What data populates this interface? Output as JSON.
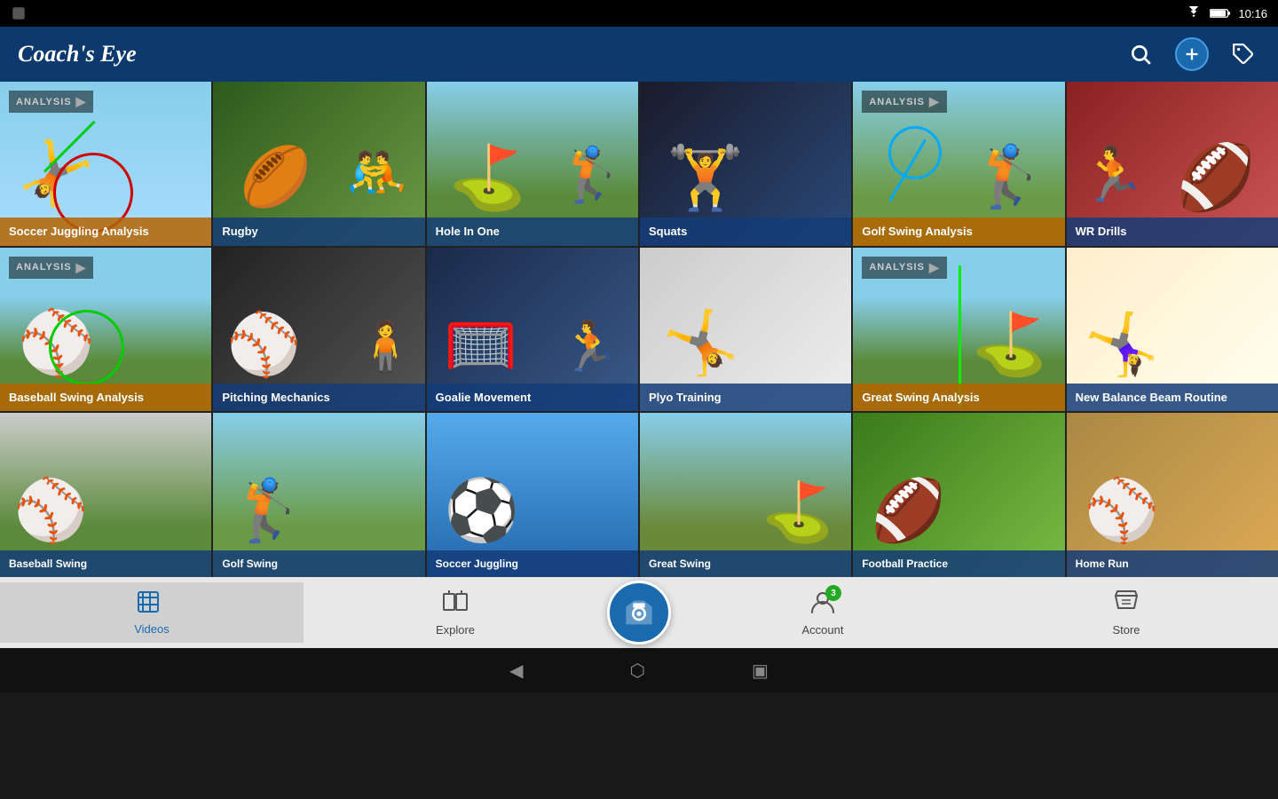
{
  "statusBar": {
    "time": "10:16",
    "icons": [
      "wifi",
      "battery"
    ]
  },
  "topBar": {
    "title": "Coach's Eye",
    "actions": [
      "search",
      "add",
      "tag"
    ]
  },
  "grid": {
    "rows": [
      [
        {
          "id": "soccer-juggling",
          "label": "Soccer Juggling Analysis",
          "hasAnalysis": true,
          "labelColor": "orange",
          "bgClass": "cell-soccer-juggling",
          "hasCircle": true,
          "highlighted": true
        },
        {
          "id": "rugby",
          "label": "Rugby",
          "hasAnalysis": false,
          "labelColor": "blue",
          "bgClass": "cell-rugby"
        },
        {
          "id": "hole-in-one",
          "label": "Hole In One",
          "hasAnalysis": false,
          "labelColor": "blue",
          "bgClass": "cell-hole-in-one"
        },
        {
          "id": "squats",
          "label": "Squats",
          "hasAnalysis": false,
          "labelColor": "blue",
          "bgClass": "cell-squats"
        },
        {
          "id": "golf-swing-analysis",
          "label": "Golf Swing Analysis",
          "hasAnalysis": true,
          "labelColor": "orange",
          "bgClass": "cell-golf-swing"
        },
        {
          "id": "wr-drills",
          "label": "WR Drills",
          "hasAnalysis": false,
          "labelColor": "blue",
          "bgClass": "cell-wr-drills"
        }
      ],
      [
        {
          "id": "baseball-swing-analysis",
          "label": "Baseball Swing Analysis",
          "hasAnalysis": true,
          "labelColor": "orange",
          "bgClass": "cell-baseball-swing",
          "hasCircleGreen": true
        },
        {
          "id": "pitching-mechanics",
          "label": "Pitching Mechanics",
          "hasAnalysis": false,
          "labelColor": "blue",
          "bgClass": "cell-pitching"
        },
        {
          "id": "goalie-movement",
          "label": "Goalie Movement",
          "hasAnalysis": false,
          "labelColor": "blue",
          "bgClass": "cell-goalie"
        },
        {
          "id": "plyo-training",
          "label": "Plyo Training",
          "hasAnalysis": false,
          "labelColor": "blue",
          "bgClass": "cell-plyo"
        },
        {
          "id": "great-swing-analysis",
          "label": "Great Swing Analysis",
          "hasAnalysis": true,
          "labelColor": "orange",
          "bgClass": "cell-great-swing",
          "hasVertLine": true
        },
        {
          "id": "new-balance-beam",
          "label": "New Balance Beam Routine",
          "hasAnalysis": false,
          "labelColor": "blue",
          "bgClass": "cell-balance-beam"
        }
      ],
      [
        {
          "id": "baseball-swing2",
          "label": "Baseball Swing",
          "hasAnalysis": false,
          "labelColor": "blue",
          "bgClass": "cell-baseball-swing2"
        },
        {
          "id": "golf-swing2",
          "label": "Golf Swing",
          "hasAnalysis": false,
          "labelColor": "blue",
          "bgClass": "cell-golf-swing2"
        },
        {
          "id": "soccer-juggling2",
          "label": "Soccer Juggling",
          "hasAnalysis": false,
          "labelColor": "blue",
          "bgClass": "cell-soccer-juggling2"
        },
        {
          "id": "great-swing2",
          "label": "Great Swing",
          "hasAnalysis": false,
          "labelColor": "blue",
          "bgClass": "cell-great-swing2"
        },
        {
          "id": "football-practice",
          "label": "Football Practice",
          "hasAnalysis": false,
          "labelColor": "blue",
          "bgClass": "cell-football"
        },
        {
          "id": "home-run",
          "label": "Home Run",
          "hasAnalysis": false,
          "labelColor": "blue",
          "bgClass": "cell-home-run"
        }
      ]
    ]
  },
  "bottomNav": {
    "items": [
      {
        "id": "videos",
        "label": "Videos",
        "icon": "🎬",
        "active": true
      },
      {
        "id": "explore",
        "label": "Explore",
        "icon": "🗺",
        "active": false
      },
      {
        "id": "camera",
        "label": "",
        "icon": "📹",
        "isCenter": true
      },
      {
        "id": "account",
        "label": "Account",
        "icon": "👤",
        "active": false,
        "badge": "3"
      },
      {
        "id": "store",
        "label": "Store",
        "icon": "🏷",
        "active": false
      }
    ]
  },
  "systemNav": {
    "back": "◀",
    "home": "⬡",
    "recent": "▣"
  }
}
